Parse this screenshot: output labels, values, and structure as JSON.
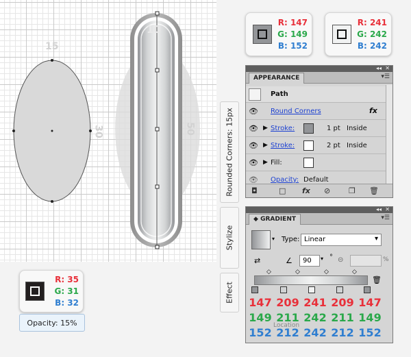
{
  "canvas": {
    "dimension_labels": {
      "top_small": "15",
      "top_big": "10",
      "side_small": "30",
      "side_big": "50"
    }
  },
  "swatch_gray": {
    "r": "R: 147",
    "g": "G: 149",
    "b": "B: 152",
    "color": "#939598"
  },
  "swatch_light": {
    "r": "R: 241",
    "g": "G: 242",
    "b": "B: 242",
    "color": "#f1f2f2"
  },
  "swatch_dark": {
    "r": "R: 35",
    "g": "G: 31",
    "b": "B: 32",
    "color": "#231f20"
  },
  "opacity_button": {
    "label": "Opacity: 15%"
  },
  "vertical_tabs": {
    "rounded": "Rounded Corners: 15px",
    "stylize": "Stylize",
    "effect": "Effect"
  },
  "appearance": {
    "title": "APPEARANCE",
    "path_label": "Path",
    "round_corners": "Round Corners",
    "fx": "fx",
    "stroke1": {
      "label": "Stroke:",
      "weight": "1 pt",
      "position": "Inside",
      "color": "#939598"
    },
    "stroke2": {
      "label": "Stroke:",
      "weight": "2 pt",
      "position": "Inside",
      "color": "#ffffff"
    },
    "fill": {
      "label": "Fill:"
    },
    "opacity": {
      "label": "Opacity:",
      "value": "Default"
    }
  },
  "gradient": {
    "title": "GRADIENT",
    "type_label": "Type:",
    "type_value": "Linear",
    "angle_value": "90",
    "degree": "°",
    "percent": "%",
    "location_label": "Location",
    "stops": [
      {
        "r": "147",
        "g": "149",
        "b": "152"
      },
      {
        "r": "209",
        "g": "211",
        "b": "212"
      },
      {
        "r": "241",
        "g": "242",
        "b": "242"
      },
      {
        "r": "209",
        "g": "211",
        "b": "212"
      },
      {
        "r": "147",
        "g": "149",
        "b": "152"
      }
    ]
  },
  "colors": {
    "red": "#e8303a",
    "green": "#2aa84a",
    "blue": "#2f7ed0",
    "panel": "#d5d5d5"
  }
}
